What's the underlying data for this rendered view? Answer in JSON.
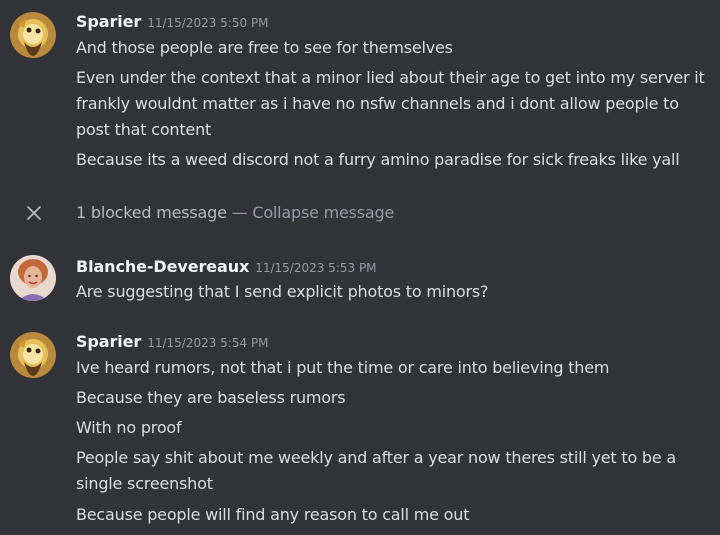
{
  "messages": [
    {
      "username": "Sparier",
      "timestamp": "11/15/2023 5:50 PM",
      "lines": [
        "And those people are free to see for themselves",
        "Even under the context that a minor lied about their age to get into my server it frankly wouldnt matter as i have no nsfw channels and i dont allow people to post that content",
        "Because its a weed discord not a furry amino paradise for sick freaks like yall"
      ]
    },
    {
      "username": "Blanche-Devereaux",
      "timestamp": "11/15/2023 5:53 PM",
      "lines": [
        "Are suggesting that I send explicit photos to minors?"
      ]
    },
    {
      "username": "Sparier",
      "timestamp": "11/15/2023 5:54 PM",
      "lines": [
        "Ive heard rumors, not that i put the time or care into believing them",
        "Because they are baseless rumors",
        "With no proof",
        "People say shit about me weekly and after a year now theres still yet to be a single screenshot",
        "Because people will find any reason to call me out"
      ]
    }
  ],
  "blocked": {
    "count_label": "1 blocked message",
    "separator": "—",
    "collapse_label": "Collapse message",
    "icon": "close-icon"
  },
  "colors": {
    "background": "#313338",
    "username": "#f2f3f5",
    "timestamp": "#949ba4",
    "message_text": "#dbdee1",
    "muted": "#949ba4"
  }
}
